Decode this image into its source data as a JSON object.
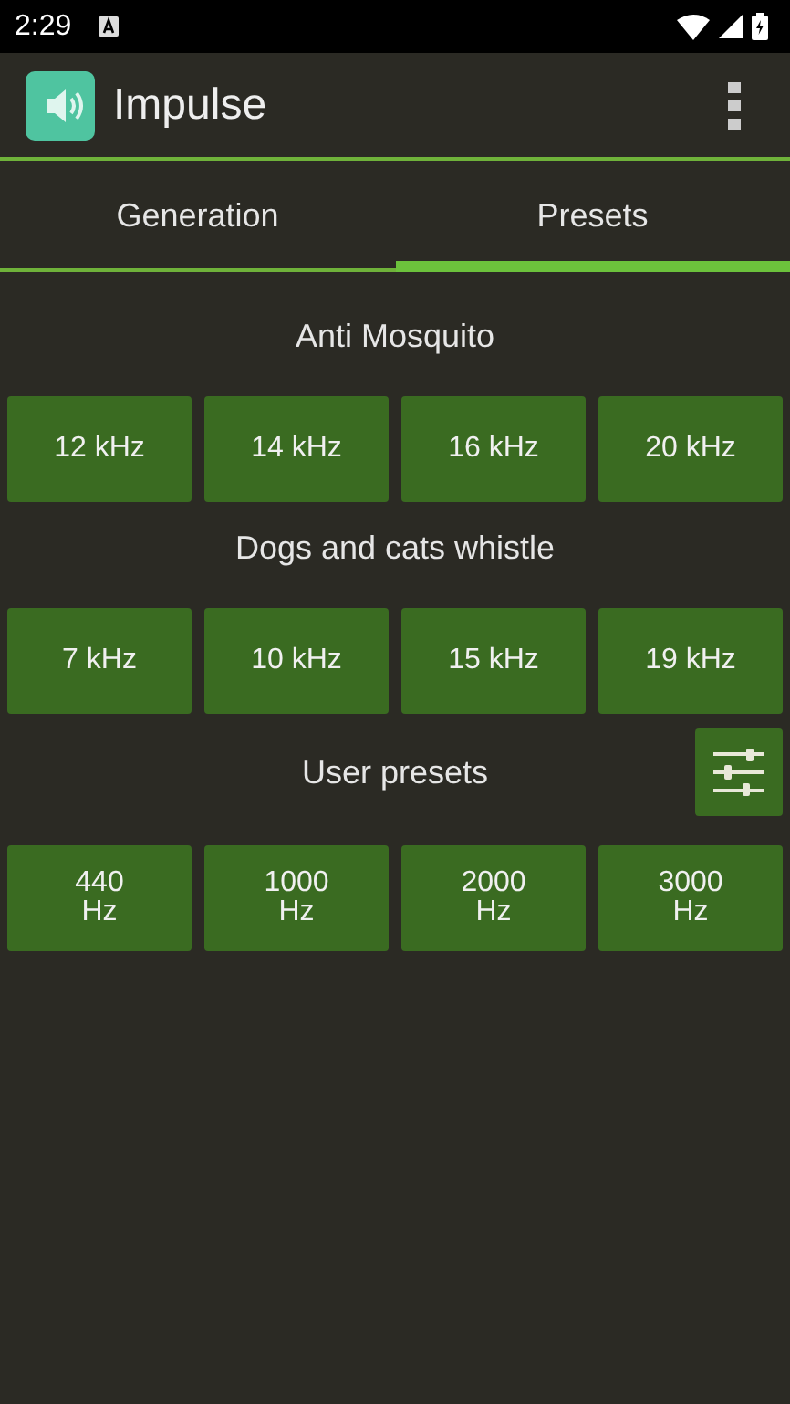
{
  "status_bar": {
    "time": "2:29"
  },
  "app_bar": {
    "title": "Impulse"
  },
  "tabs": [
    {
      "label": "Generation",
      "selected": false
    },
    {
      "label": "Presets",
      "selected": true
    }
  ],
  "sections": [
    {
      "kind": "fixed",
      "title": "Anti Mosquito",
      "presets": [
        "12 kHz",
        "14 kHz",
        "16 kHz",
        "20 kHz"
      ]
    },
    {
      "kind": "fixed",
      "title": "Dogs and cats whistle",
      "presets": [
        "7 kHz",
        "10 kHz",
        "15 kHz",
        "19 kHz"
      ]
    },
    {
      "kind": "user",
      "title": "User presets",
      "presets": [
        "440 Hz",
        "1000 Hz",
        "2000 Hz",
        "3000 Hz"
      ]
    }
  ]
}
